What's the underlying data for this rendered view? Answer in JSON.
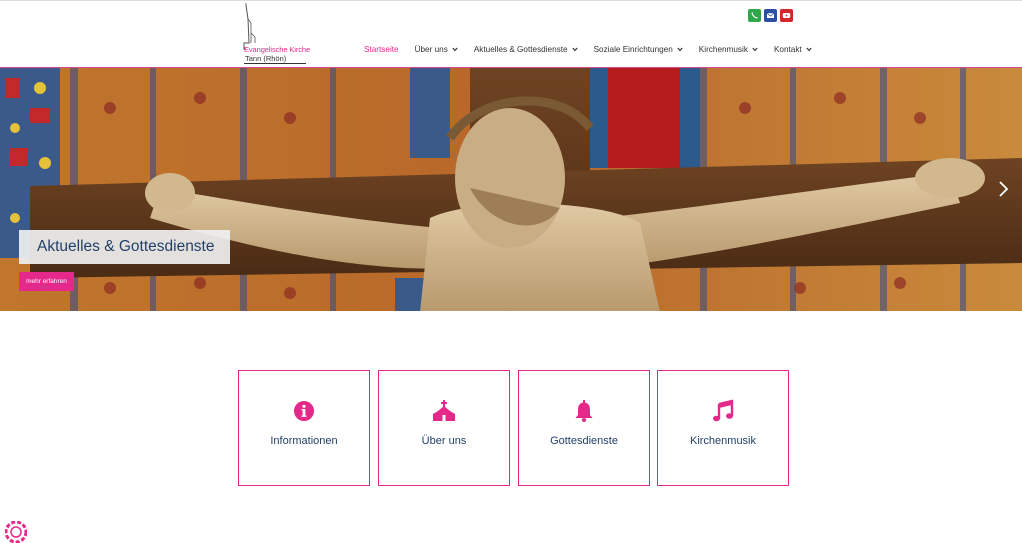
{
  "logo": {
    "line1": "Evangelische Kirche",
    "line2": "Tann (Rhön)"
  },
  "social": [
    {
      "name": "phone-icon",
      "color": "#2ea84b"
    },
    {
      "name": "mail-icon",
      "color": "#2c4fa3"
    },
    {
      "name": "youtube-icon",
      "color": "#d3272c"
    }
  ],
  "nav": {
    "items": [
      {
        "label": "Startseite",
        "active": true,
        "dropdown": false
      },
      {
        "label": "Über uns",
        "dropdown": true
      },
      {
        "label": "Aktuelles & Gottesdienste",
        "dropdown": true
      },
      {
        "label": "Soziale Einrichtungen",
        "dropdown": true
      },
      {
        "label": "Kirchenmusik",
        "dropdown": true
      },
      {
        "label": "Kontakt",
        "dropdown": true
      }
    ]
  },
  "hero": {
    "title": "Aktuelles & Gottesdienste",
    "button_label": "mehr erfahren"
  },
  "boxes": [
    {
      "label": "Informationen",
      "icon": "info-icon"
    },
    {
      "label": "Über uns",
      "icon": "church-icon"
    },
    {
      "label": "Gottesdienste",
      "icon": "bell-icon"
    },
    {
      "label": "Kirchenmusik",
      "icon": "music-note-icon"
    }
  ],
  "colors": {
    "accent": "#e5298b",
    "text_blue": "#24406a"
  }
}
